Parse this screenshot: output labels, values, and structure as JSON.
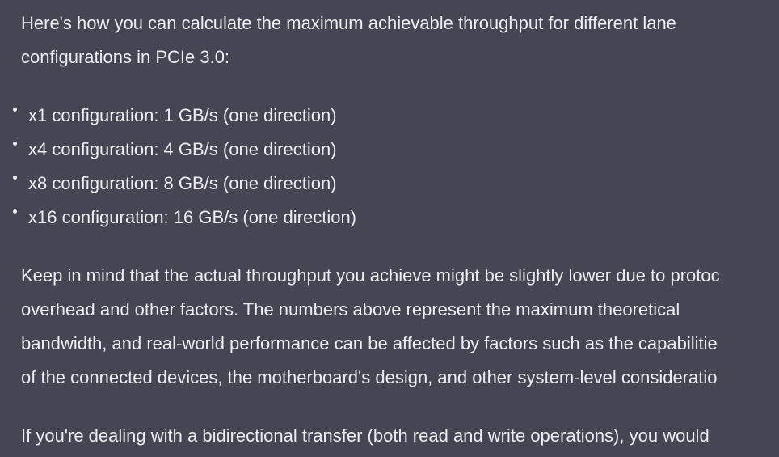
{
  "message": {
    "intro_lines": [
      "Here's how you can calculate the maximum achievable throughput for different lane",
      "configurations in PCIe 3.0:"
    ],
    "bullets": [
      "x1 configuration: 1 GB/s (one direction)",
      "x4 configuration: 4 GB/s (one direction)",
      "x8 configuration: 8 GB/s (one direction)",
      "x16 configuration: 16 GB/s (one direction)"
    ],
    "caveat_lines": [
      "Keep in mind that the actual throughput you achieve might be slightly lower due to protoc",
      "overhead and other factors. The numbers above represent the maximum theoretical",
      "bandwidth, and real-world performance can be affected by factors such as the capabilitie",
      "of the connected devices, the motherboard's design, and other system-level consideratio"
    ],
    "followup_lines": [
      "If you're dealing with a bidirectional transfer (both read and write operations), you would"
    ]
  }
}
